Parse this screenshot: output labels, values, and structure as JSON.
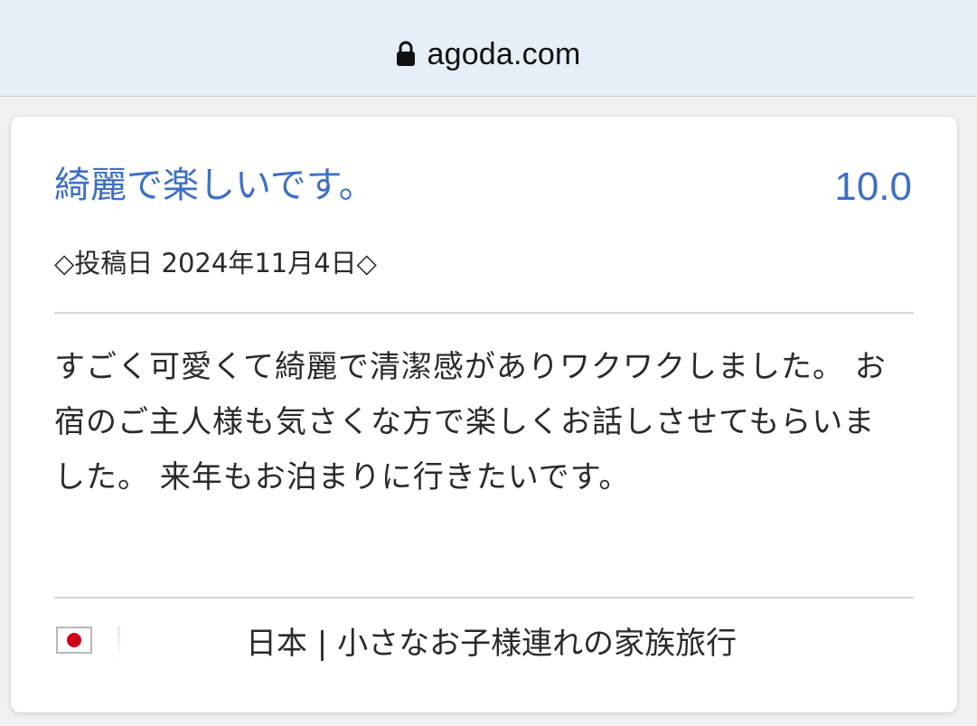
{
  "browser": {
    "url": "agoda.com",
    "lock_icon": "lock-icon"
  },
  "review": {
    "title": "綺麗で楽しいです。",
    "score": "10.0",
    "posted_date": "◇投稿日 2024年11月4日◇",
    "body": "すごく可愛くて綺麗で清潔感がありワクワクしました。 お宿のご主人様も気さくな方で楽しくお話しさせてもらいました。 来年もお泊まりに行きたいです。",
    "reviewer": {
      "flag_icon": "japan-flag-icon",
      "info": "日本 | 小さなお子様連れの家族旅行"
    }
  },
  "colors": {
    "accent": "#3e6fc5",
    "address_bar": "#e6eef8",
    "text": "#2a2a2a"
  }
}
